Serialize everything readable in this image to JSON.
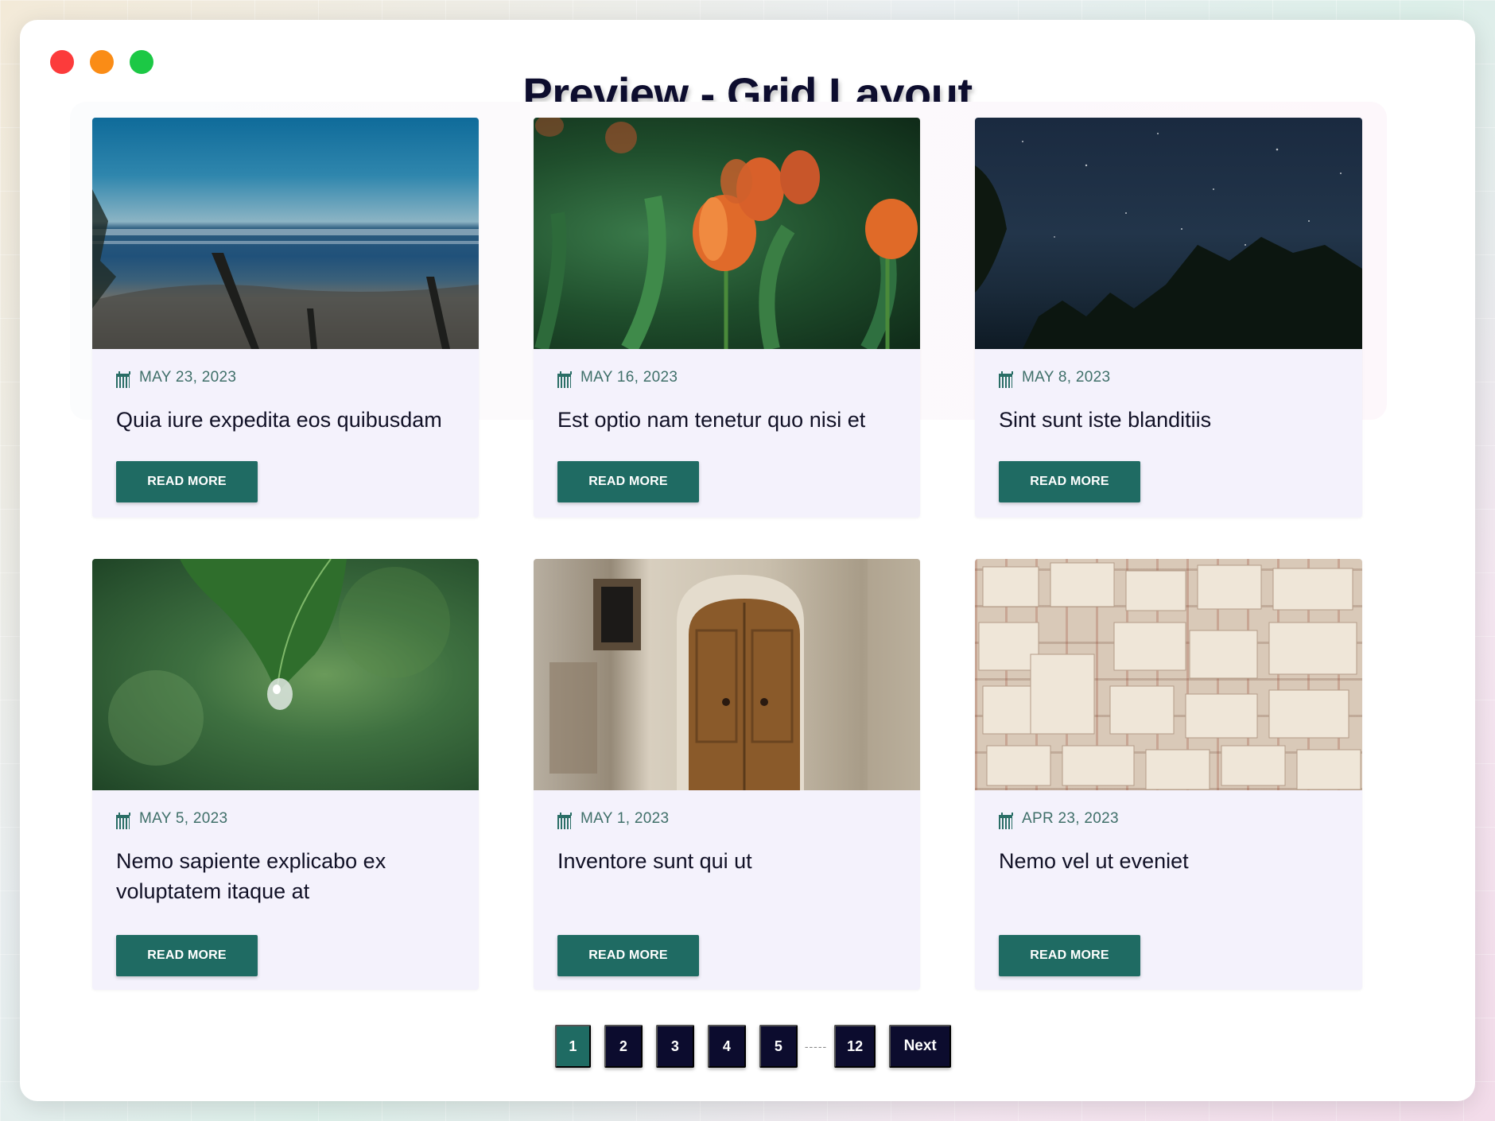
{
  "window": {
    "title": "Preview - Grid Layout"
  },
  "posts": [
    {
      "date": "MAY 23, 2023",
      "title": "Quia iure expedita eos quibusdam",
      "button": "READ MORE",
      "image": "beach-photo"
    },
    {
      "date": "MAY 16, 2023",
      "title": "Est optio nam tenetur quo nisi et",
      "button": "READ MORE",
      "image": "tulips-photo"
    },
    {
      "date": "MAY 8, 2023",
      "title": "Sint sunt iste blanditiis",
      "button": "READ MORE",
      "image": "night-sky-photo"
    },
    {
      "date": "MAY 5, 2023",
      "title": "Nemo sapiente explicabo ex voluptatem itaque at",
      "button": "READ MORE",
      "image": "leaf-drop-photo"
    },
    {
      "date": "MAY 1, 2023",
      "title": "Inventore sunt qui ut",
      "button": "READ MORE",
      "image": "wooden-door-photo"
    },
    {
      "date": "APR 23, 2023",
      "title": "Nemo vel ut eveniet",
      "button": "READ MORE",
      "image": "sheet-music-photo"
    }
  ],
  "pagination": {
    "pages": [
      "1",
      "2",
      "3",
      "4",
      "5"
    ],
    "ellipsis": "-----",
    "last": "12",
    "next": "Next",
    "active": "1"
  },
  "colors": {
    "accent": "#1f6b63",
    "page_button": "#0c0c2e",
    "card_bg": "#f4f2fc",
    "date_text": "#3f6f69",
    "traffic_red": "#fc3b3b",
    "traffic_orange": "#fa8c16",
    "traffic_green": "#1cc845"
  },
  "icons": {
    "date": "calendar-icon"
  }
}
